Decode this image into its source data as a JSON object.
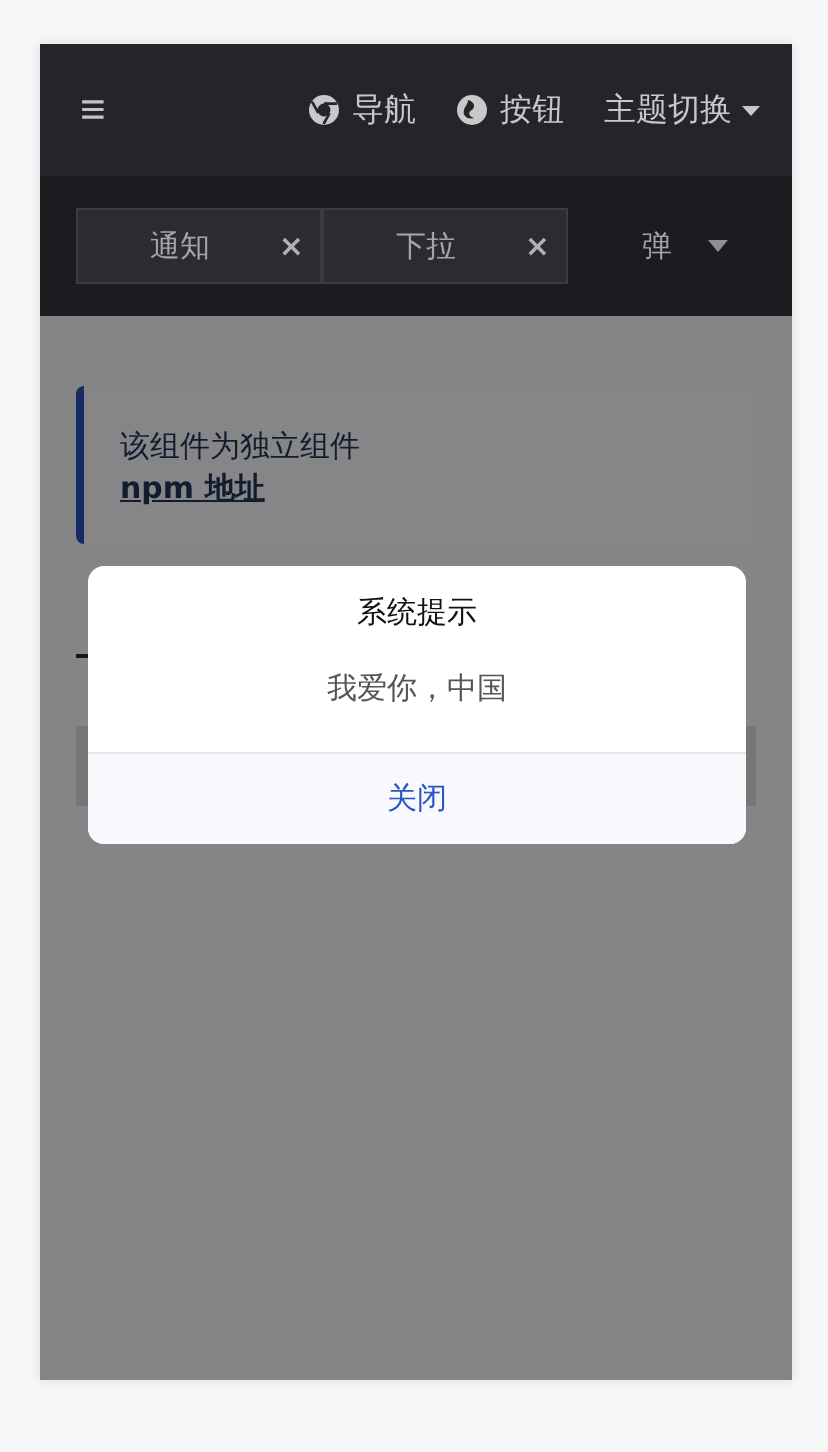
{
  "navbar": {
    "menu_icon": "≡",
    "links": [
      {
        "kind": "chrome",
        "label": "导航"
      },
      {
        "kind": "firefox",
        "label": "按钮"
      }
    ],
    "dropdown": {
      "label": "主题切换"
    }
  },
  "tabs": [
    {
      "label": "通知",
      "selected": false,
      "closable": true
    },
    {
      "label": "下拉",
      "selected": false,
      "closable": true
    },
    {
      "label": "弹",
      "selected": true,
      "closable": false
    }
  ],
  "tab_close": "×",
  "notice": {
    "text": "该组件为独立组件",
    "link": "npm 地址"
  },
  "dialog": {
    "title": "系统提示",
    "message": "我爱你，中国",
    "button": "关闭"
  }
}
